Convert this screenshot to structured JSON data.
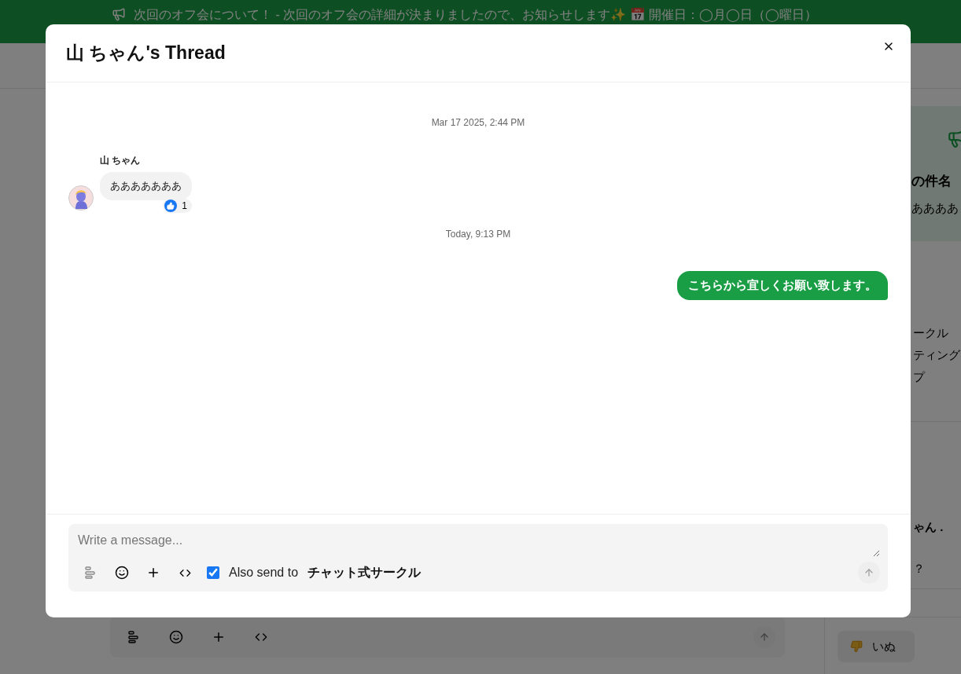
{
  "banner": {
    "text": "次回のオフ会について！ - 次回のオフ会の詳細が決まりましたので、お知らせします✨ 📅 開催日：◯月◯日（◯曜日）"
  },
  "sidebar": {
    "announcement": {
      "title": "の件名",
      "body": "ああああ"
    },
    "items": [
      {
        "kind": "plain",
        "lines": [
          "ークル"
        ]
      },
      {
        "kind": "plain",
        "lines": [
          "ティング",
          "プ"
        ]
      },
      {
        "kind": "bold",
        "lines": [
          "ゃん ."
        ]
      },
      {
        "kind": "plain",
        "lines": [
          "？"
        ]
      }
    ],
    "reaction": {
      "label": "いぬ"
    }
  },
  "thread": {
    "title": "山 ちゃん's Thread",
    "messages": [
      {
        "kind": "date",
        "text": "Mar 17 2025, 2:44 PM"
      },
      {
        "kind": "incoming",
        "author": "山 ちゃん",
        "text": "あああああああ",
        "reaction_count": "1"
      },
      {
        "kind": "date",
        "text": "Today, 9:13 PM"
      },
      {
        "kind": "outgoing",
        "text": "こちらから宜しくお願い致します。"
      }
    ],
    "composer": {
      "placeholder": "Write a message...",
      "also_send": {
        "checked": true,
        "label": "Also send to",
        "target": "チャット式サークル"
      }
    }
  }
}
